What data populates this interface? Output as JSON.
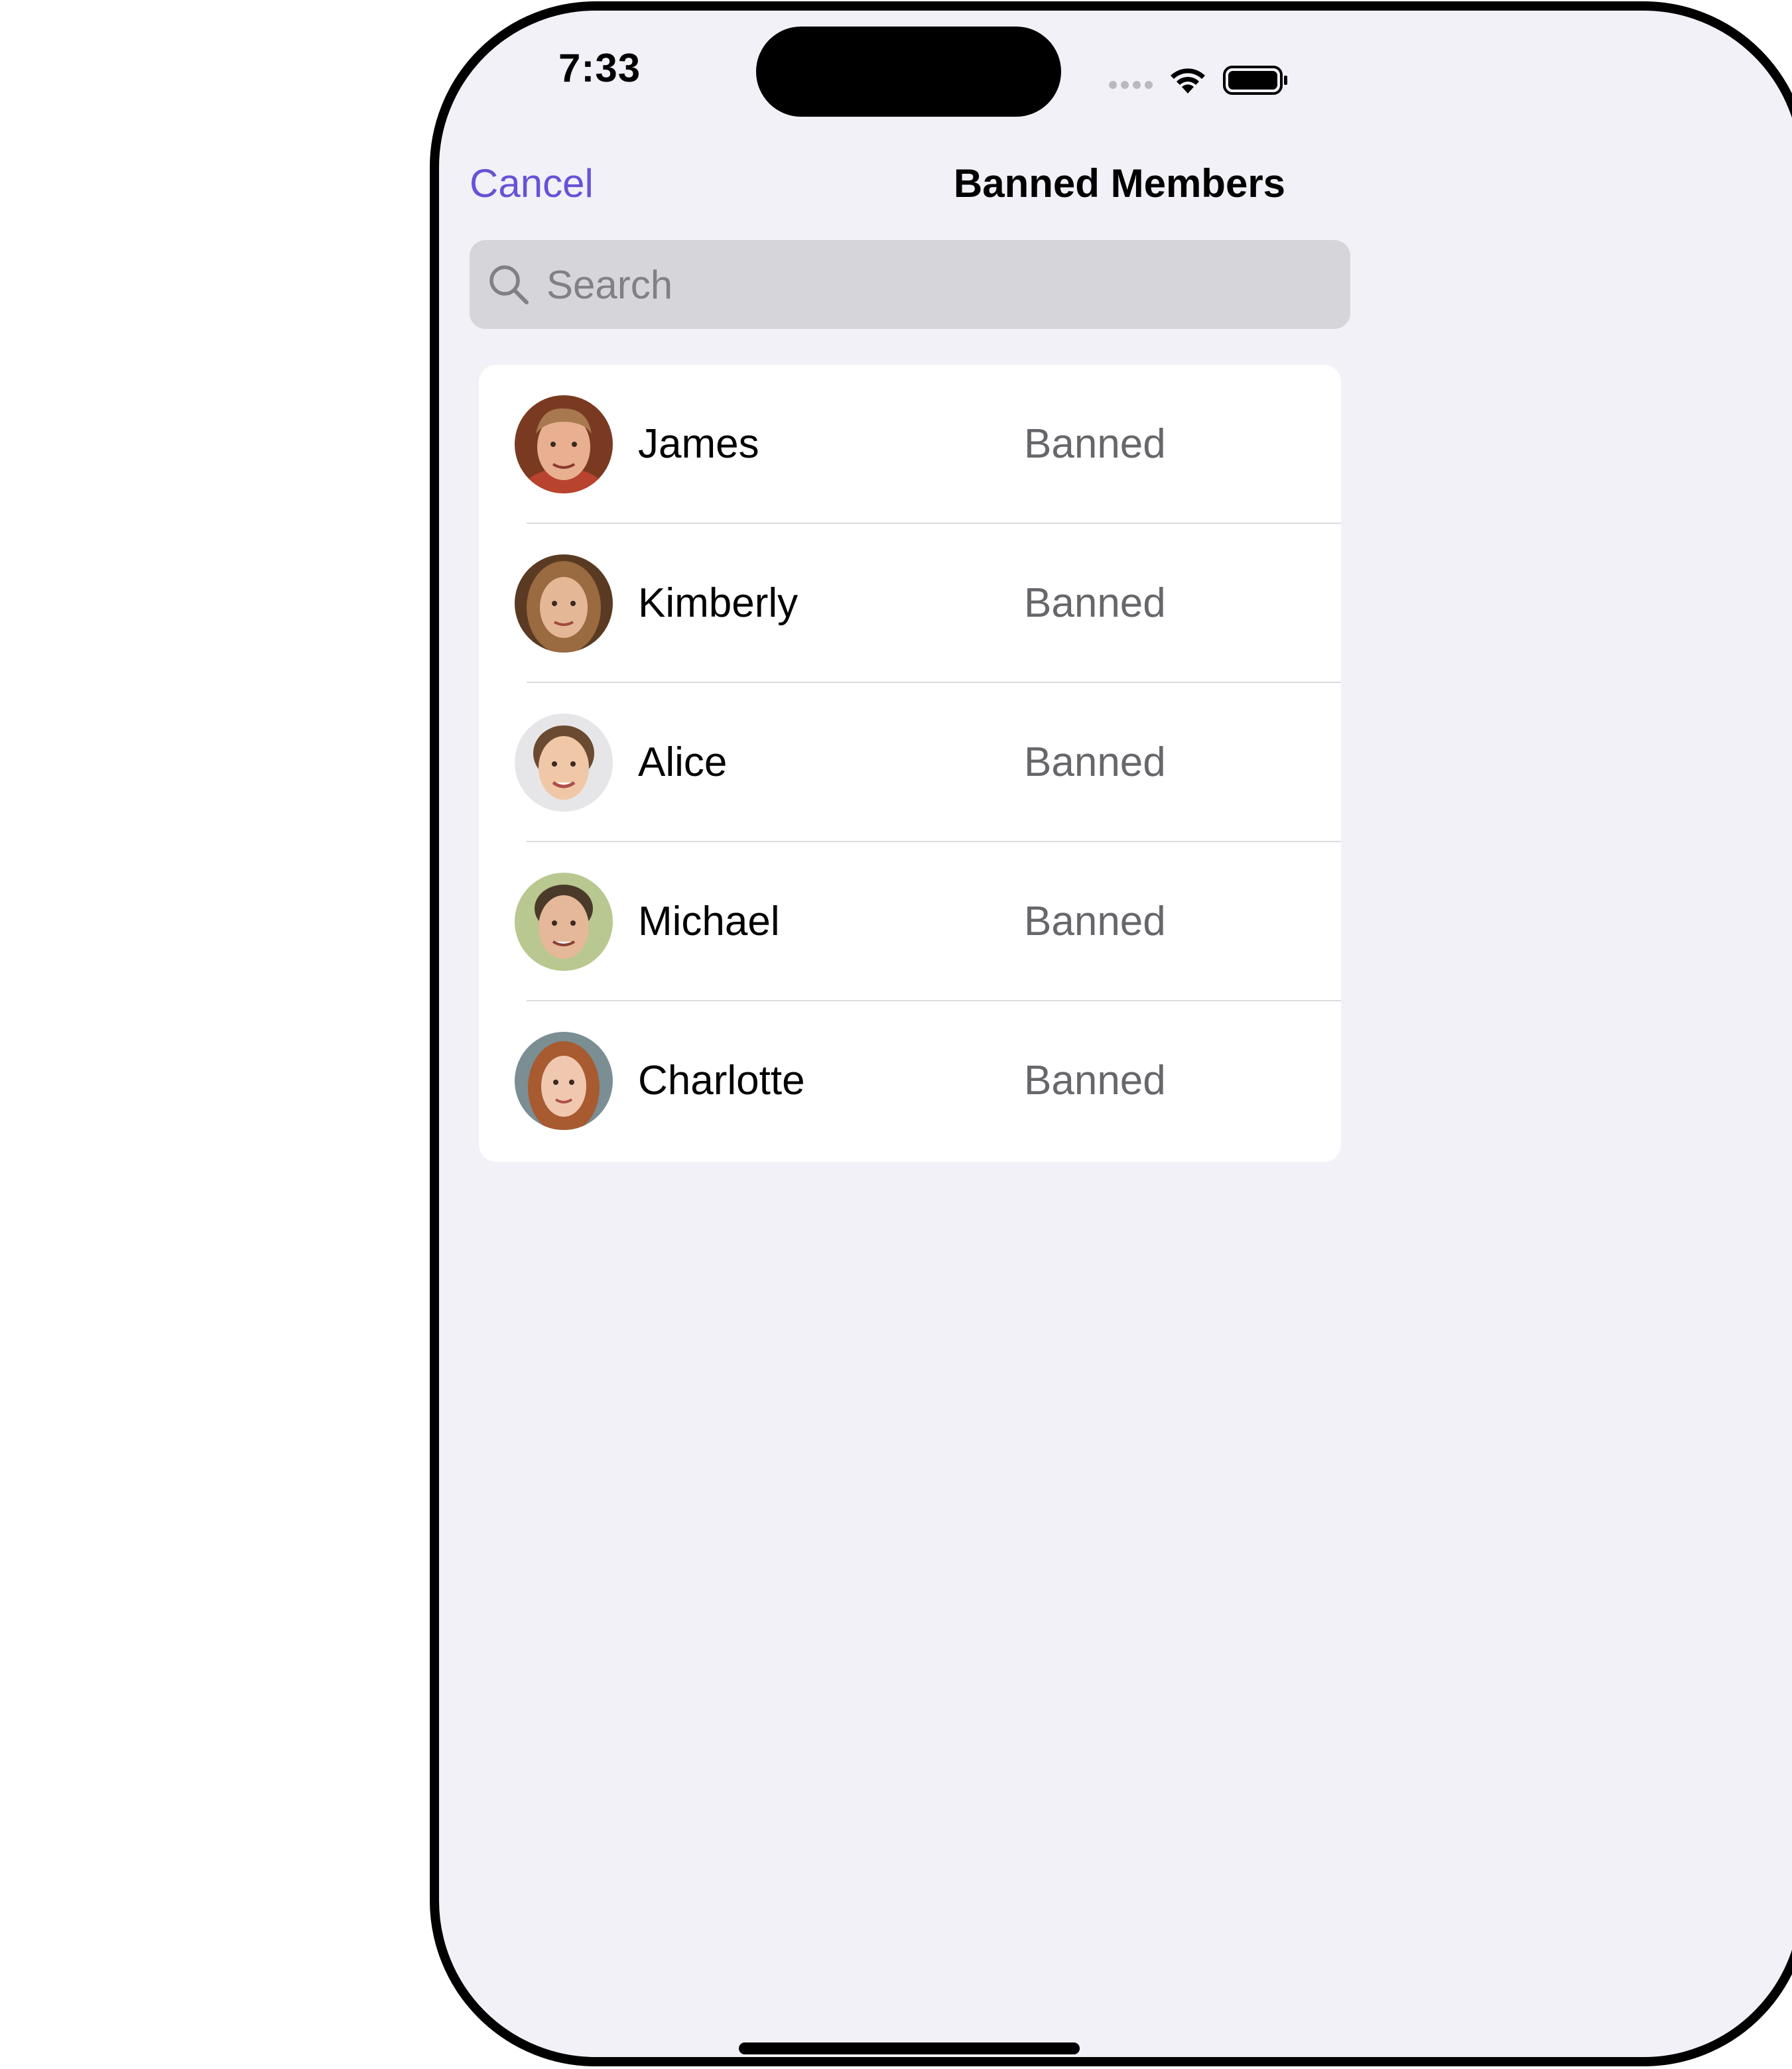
{
  "status_bar": {
    "time": "7:33"
  },
  "nav": {
    "cancel_label": "Cancel",
    "title": "Banned Members"
  },
  "search": {
    "placeholder": "Search",
    "value": ""
  },
  "members": [
    {
      "name": "James",
      "status": "Banned"
    },
    {
      "name": "Kimberly",
      "status": "Banned"
    },
    {
      "name": "Alice",
      "status": "Banned"
    },
    {
      "name": "Michael",
      "status": "Banned"
    },
    {
      "name": "Charlotte",
      "status": "Banned"
    }
  ],
  "colors": {
    "accent": "#6852d6",
    "background": "#f2f1f7",
    "search_field": "#d5d5da",
    "secondary_text": "#67676b"
  },
  "icons": {
    "search": "search-icon",
    "wifi": "wifi-icon",
    "battery": "battery-icon",
    "signal": "cellular-signal-icon"
  }
}
